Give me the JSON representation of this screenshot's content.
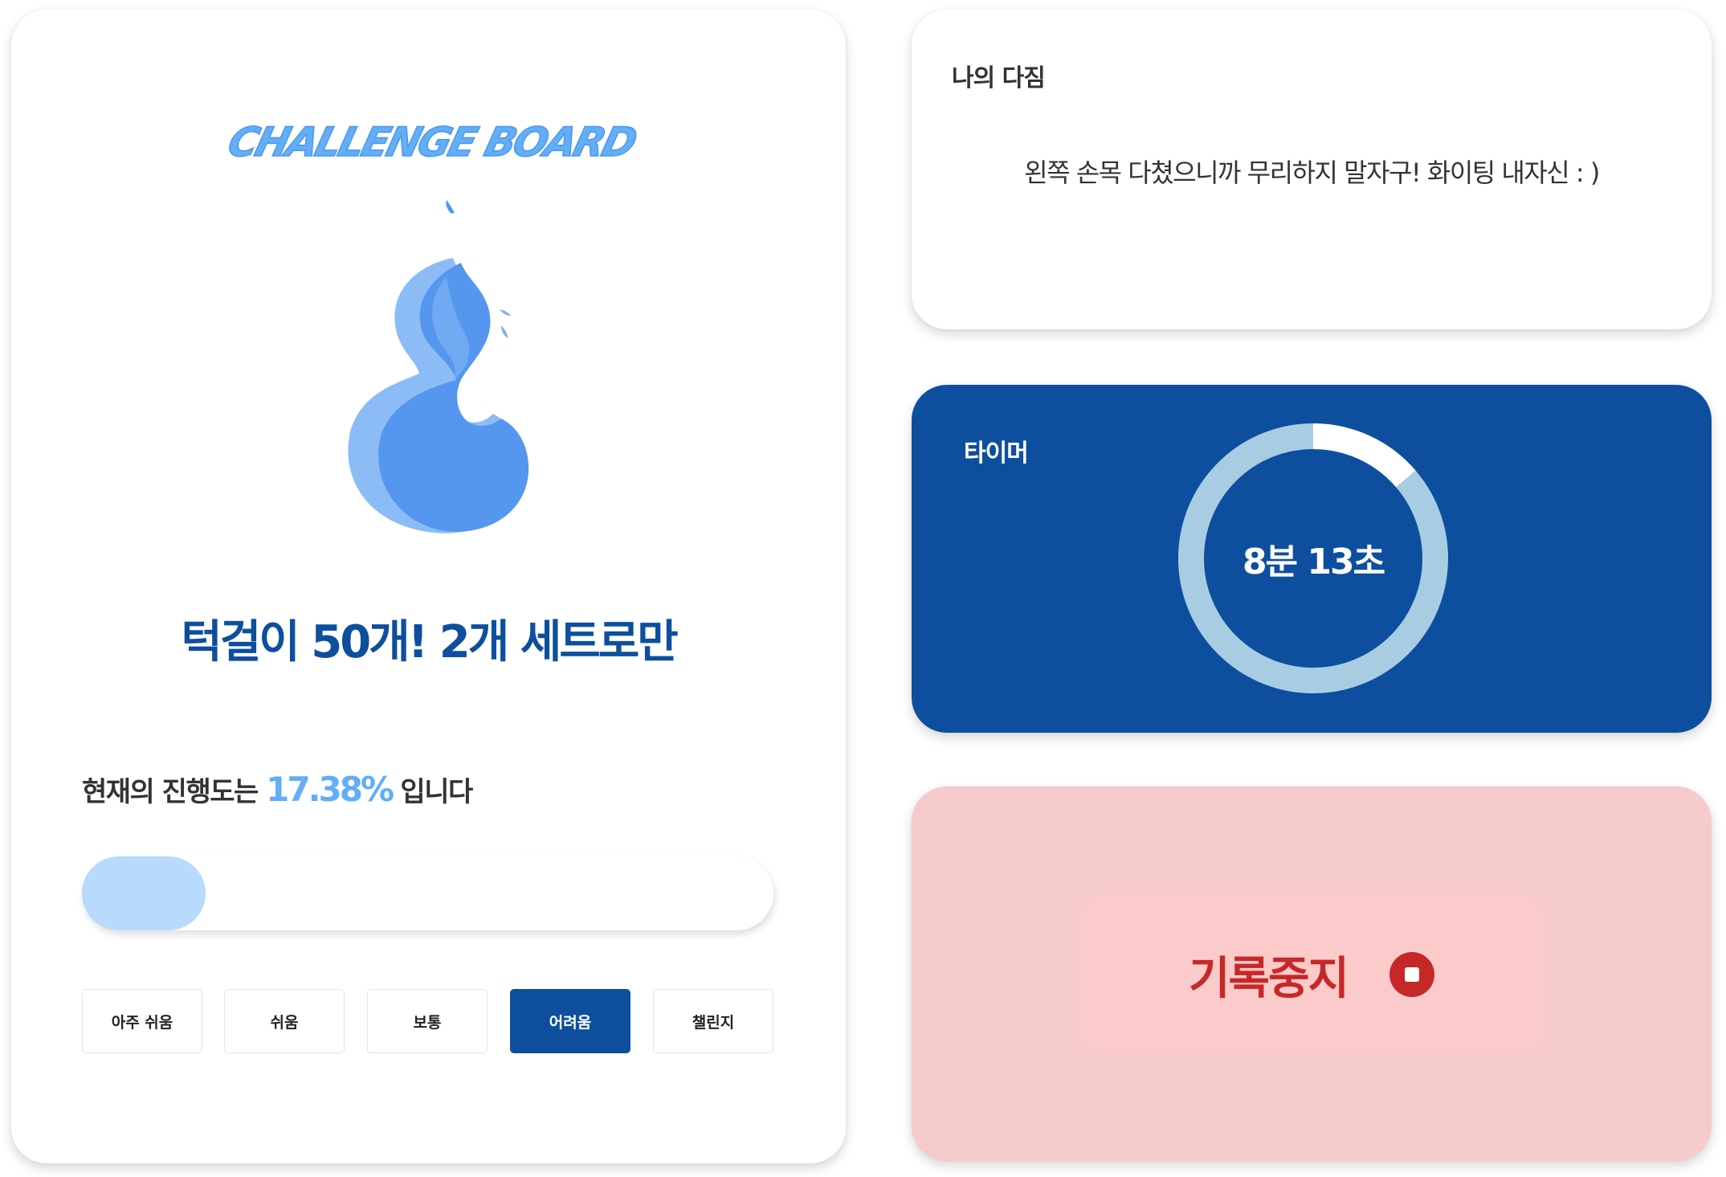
{
  "logo_text": "CHALLENGE BOARD",
  "challenge": {
    "title": "턱걸이 50개! 2개 세트로만",
    "progress_prefix": "현재의 진행도는",
    "progress_value": "17.38%",
    "progress_suffix": "입니다",
    "progress_fraction": 0.1738
  },
  "difficulty": {
    "options": [
      "아주 쉬움",
      "쉬움",
      "보통",
      "어려움",
      "챌린지"
    ],
    "selected": "어려움"
  },
  "pledge": {
    "title": "나의 다짐",
    "text": "왼쪽 손목 다쳤으니까 무리하지 말자구! 화이팅 내자신 : )"
  },
  "timer": {
    "title": "타이머",
    "value": "8분 13초",
    "ring_progress": 0.137
  },
  "stop": {
    "label": "기록중지",
    "icon": "stop-icon"
  },
  "colors": {
    "primary": "#0d4f9e",
    "accent": "#62aef7",
    "progress_fill": "#b7dafd",
    "flame": "#5596ef",
    "stop_red": "#c62828",
    "stop_bg": "#f5cbcc",
    "ring_track": "#a8cde3"
  }
}
